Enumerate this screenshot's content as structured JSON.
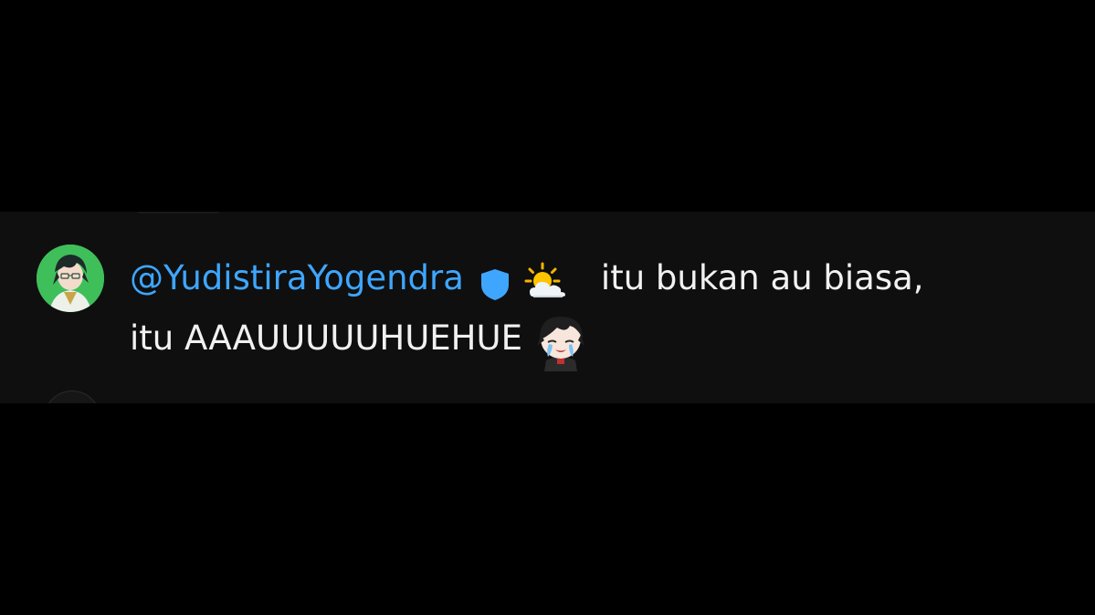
{
  "colors": {
    "background": "#000000",
    "panel": "#0f0f0f",
    "username": "#3ea6ff",
    "text": "#f1f1f1",
    "avatar_bg": "#3fbf5a"
  },
  "comment": {
    "author_avatar_icon": "anime-character-avatar",
    "username": "@YudistiraYogendra",
    "badge_icon": "blue-shield-badge-icon",
    "emoji_icon": "sun-behind-cloud-emoji",
    "text_line1": "itu bukan au biasa,",
    "text_line2": "itu AAAUUUUUHUEHUE",
    "sticker_icon": "crying-chibi-sticker"
  }
}
